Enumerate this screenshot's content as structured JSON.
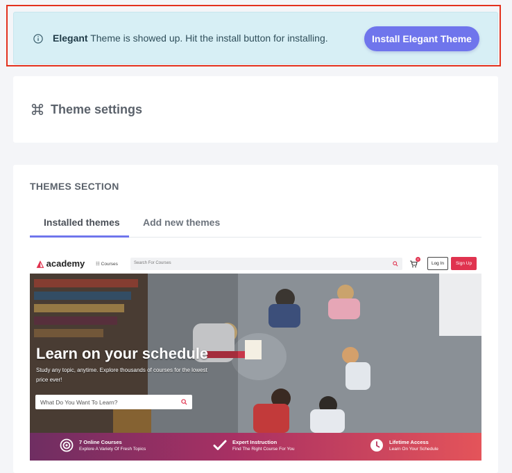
{
  "notice": {
    "theme_name": "Elegant",
    "message": "Theme is showed up. Hit the install button for installing.",
    "install_label": "Install Elegant Theme"
  },
  "settings_card": {
    "title": "Theme settings"
  },
  "themes_section": {
    "title": "THEMES SECTION",
    "tabs": [
      {
        "label": "Installed themes",
        "active": true
      },
      {
        "label": "Add new themes",
        "active": false
      }
    ]
  },
  "preview": {
    "logo": "academy",
    "courses_label": "Courses",
    "search_placeholder": "Search For Courses",
    "cart_count": "0",
    "login_label": "Log In",
    "signup_label": "Sign Up",
    "headline": "Learn on your schedule",
    "subtext": "Study any topic, anytime. Explore thousands of courses for the lowest price ever!",
    "hero_search_placeholder": "What Do You Want To Learn?",
    "features": [
      {
        "title": "7 Online Courses",
        "subtitle": "Explore A Variety Of Fresh Topics",
        "icon": "target-icon"
      },
      {
        "title": "Expert Instruction",
        "subtitle": "Find The Right Course For You",
        "icon": "check-icon"
      },
      {
        "title": "Lifetime Access",
        "subtitle": "Learn On Your Schedule",
        "icon": "clock-icon"
      }
    ]
  },
  "colors": {
    "accent": "#6f75ec",
    "notice_bg": "#d7eff5",
    "highlight_border": "#e3311d",
    "brand_red": "#e0334f"
  }
}
